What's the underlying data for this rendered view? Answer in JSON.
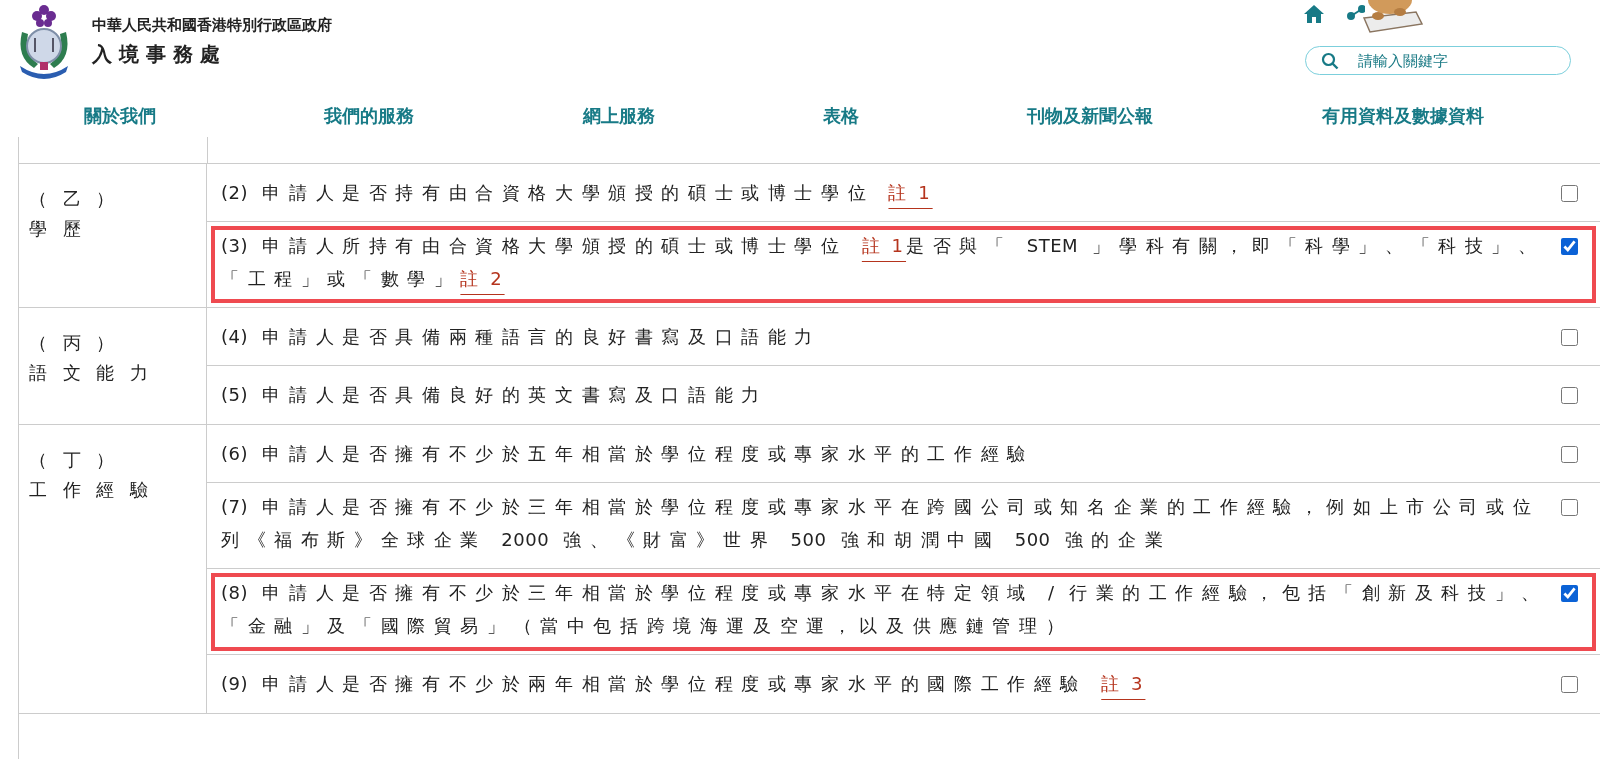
{
  "header": {
    "government": "中華人民共和國香港特別行政區政府",
    "department": "入境事務處"
  },
  "search": {
    "placeholder": "請輸入關鍵字"
  },
  "nav": [
    "關於我們",
    "我們的服務",
    "網上服務",
    "表格",
    "刊物及新聞公報",
    "有用資料及數據資料"
  ],
  "groups": [
    {
      "label": [
        "（ 乙 ）",
        "學 歷"
      ],
      "items": [
        {
          "parts": [
            {
              "text": "(2) 申請人是否持有由合資格大學頒授的碩士或博士學位 "
            },
            {
              "note": "註 1"
            }
          ],
          "checked": false
        },
        {
          "parts": [
            {
              "text": "(3) 申請人所持有由合資格大學頒授的碩士或博士學位 "
            },
            {
              "note": "註 1"
            },
            {
              "text": "是否與「 STEM 」學科有關，即「科學」、「科技」、「工程」或「數學」"
            },
            {
              "note": "註 2"
            }
          ],
          "checked": true
        }
      ]
    },
    {
      "label": [
        "（ 丙 ）",
        "語 文 能 力"
      ],
      "items": [
        {
          "parts": [
            {
              "text": "(4) 申請人是否具備兩種語言的良好書寫及口語能力"
            }
          ],
          "checked": false
        },
        {
          "parts": [
            {
              "text": "(5) 申請人是否具備良好的英文書寫及口語能力"
            }
          ],
          "checked": false
        }
      ]
    },
    {
      "label": [
        "（ 丁 ）",
        "工 作 經 驗"
      ],
      "items": [
        {
          "parts": [
            {
              "text": "(6) 申請人是否擁有不少於五年相當於學位程度或專家水平的工作經驗"
            }
          ],
          "checked": false
        },
        {
          "parts": [
            {
              "text": "(7) 申請人是否擁有不少於三年相當於學位程度或專家水平在跨國公司或知名企業的工作經驗，例如上市公司或位列《福布斯》全球企業 2000 強、《財富》世界 500 強和胡潤中國 500 強的企業"
            }
          ],
          "checked": false
        },
        {
          "parts": [
            {
              "text": "(8) 申請人是否擁有不少於三年相當於學位程度或專家水平在特定領域 / 行業的工作經驗，包括「創新及科技」、「金融」及「國際貿易」（當中包括跨境海運及空運，以及供應鏈管理）"
            }
          ],
          "checked": true
        },
        {
          "parts": [
            {
              "text": "(9) 申請人是否擁有不少於兩年相當於學位程度或專家水平的國際工作經驗 "
            },
            {
              "note": "註 3"
            }
          ],
          "checked": false
        }
      ]
    }
  ]
}
